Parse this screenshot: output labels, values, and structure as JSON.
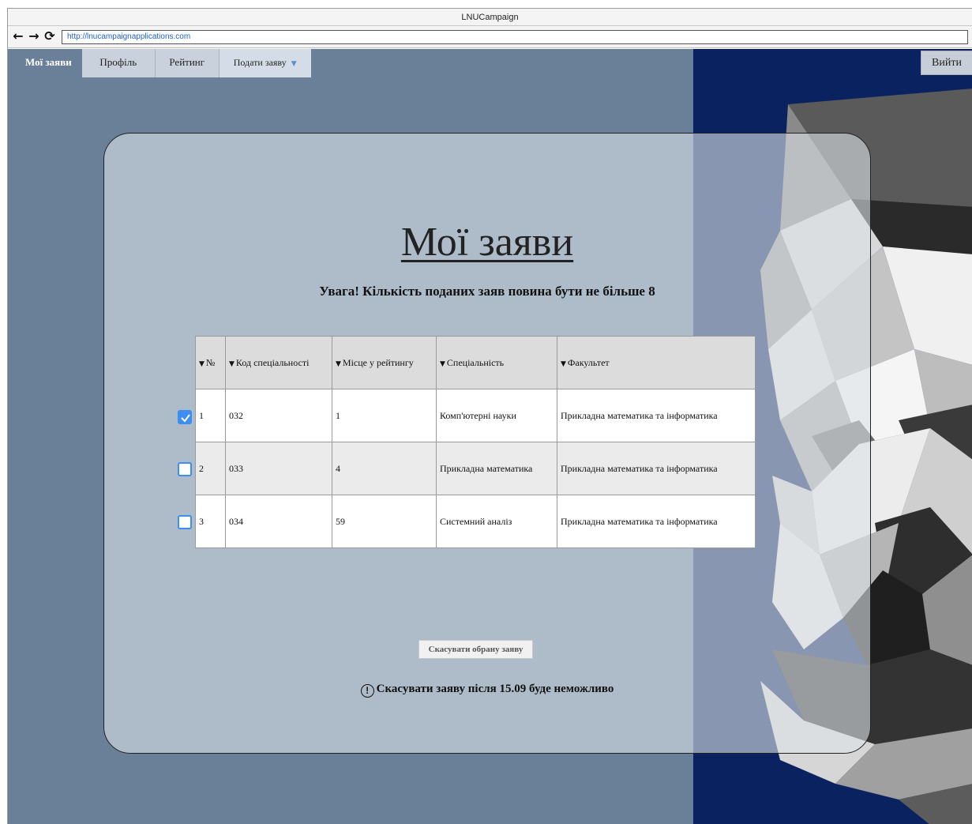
{
  "window": {
    "title": "LNUCampaign",
    "url": "http://lnucampaignapplications.com"
  },
  "nav": {
    "back_icon": "←",
    "forward_icon": "→",
    "reload_icon": "⟳",
    "items": [
      {
        "label": "Мої заяви"
      },
      {
        "label": "Профіль"
      },
      {
        "label": "Рейтинг"
      },
      {
        "label": "Подати заяву"
      }
    ],
    "logout_label": "Вийти"
  },
  "main": {
    "title": "Мої заяви",
    "warning": "Увага! Кількість поданих заяв повина бути не більше 8",
    "table": {
      "headers": [
        "№",
        "Код спеціальності",
        "Місце у рейтингу",
        "Спеціальність",
        "Факультет"
      ],
      "rows": [
        {
          "checked": true,
          "cells": [
            "1",
            "032",
            "1",
            "Комп'ютерні науки",
            "Прикладна математика та інформатика"
          ]
        },
        {
          "checked": false,
          "cells": [
            "2",
            "033",
            "4",
            "Прикладна математика",
            "Прикладна математика та інформатика"
          ]
        },
        {
          "checked": false,
          "cells": [
            "3",
            "034",
            "59",
            "Системний аналіз",
            "Прикладна математика та інформатика"
          ]
        }
      ]
    },
    "cancel_button": "Скасувати обрану заяву",
    "deadline_note": "Скасувати заяву після 15.09  буде неможливо"
  },
  "colors": {
    "page_bg": "#6a8098",
    "side_bg": "#0a2360",
    "checkbox_accent": "#3d8ef3"
  }
}
